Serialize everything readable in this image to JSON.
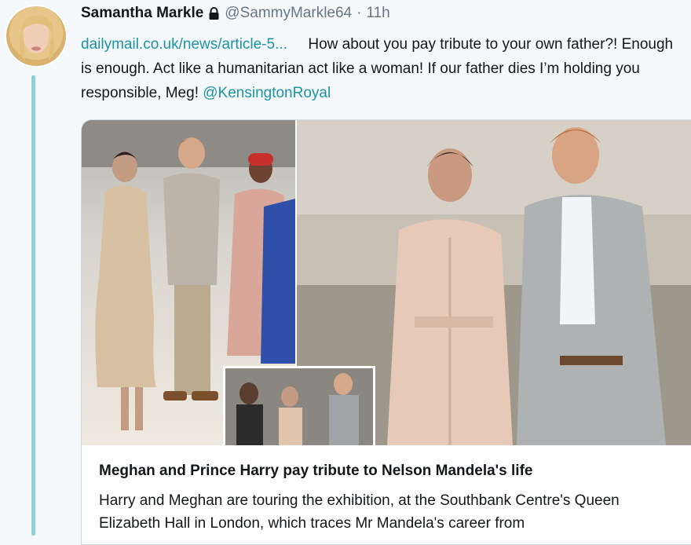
{
  "tweet": {
    "display_name": "Samantha Markle",
    "handle": "@SammyMarkle64",
    "separator": "·",
    "time": "11h",
    "link_text": "dailymail.co.uk/news/article-5...",
    "body_text": "How about you pay tribute to your own father?! Enough is enough. Act like a humanitarian act like a woman! If our father dies I’m holding you responsible, Meg!",
    "mention": "@KensingtonRoyal"
  },
  "card": {
    "title": "Meghan and Prince Harry pay tribute to Nelson Mandela's life",
    "description": "Harry and Meghan are touring the exhibition, at the Southbank Centre's Queen Elizabeth Hall in London, which traces Mr Mandela's career from"
  },
  "colors": {
    "link": "#1c94a4",
    "thread_line": "#8fd3d1",
    "muted": "#657786"
  },
  "icons": [
    "lock-icon"
  ]
}
